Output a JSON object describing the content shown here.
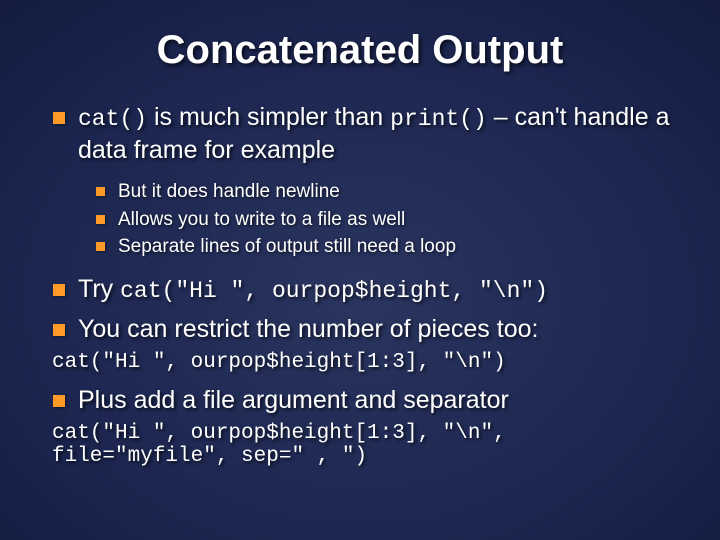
{
  "title": "Concatenated Output",
  "b1": {
    "pre": "cat()",
    "mid": " is much simpler than ",
    "code2": "print()",
    "post": " – can't handle a data frame for example"
  },
  "sub": {
    "a": "But it does handle newline",
    "b": "Allows you to write to a file as well",
    "c": "Separate lines of output still need a loop"
  },
  "b2": {
    "pre": "Try ",
    "code": "cat(\"Hi \", ourpop$height, \"\\n\")"
  },
  "b3": "You can restrict the number of pieces too:",
  "code1": "cat(\"Hi \", ourpop$height[1:3], \"\\n\")",
  "b4": "Plus add a file argument and separator",
  "code2": "cat(\"Hi \", ourpop$height[1:3], \"\\n\", file=\"myfile\", sep=\" , \")"
}
